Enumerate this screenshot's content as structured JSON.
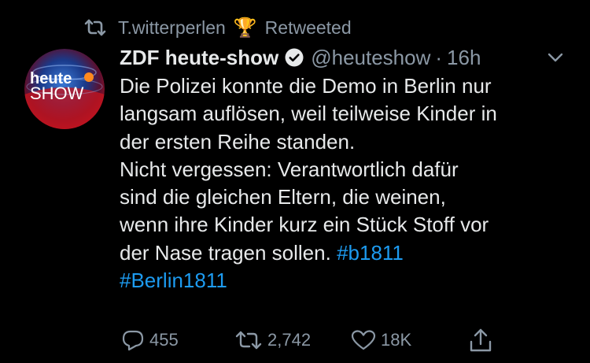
{
  "retweet": {
    "user": "T.witterperlen",
    "trophy_emoji": "🏆",
    "label": "Retweeted",
    "icon": "retweet-icon"
  },
  "author": {
    "display_name": "ZDF heute-show",
    "verified": true,
    "handle": "@heuteshow",
    "separator": "·",
    "time": "16h",
    "avatar_text_top": "heute",
    "avatar_text_bottom": "SHOW",
    "avatar_colors": [
      "#1f3f86",
      "#b3121f"
    ]
  },
  "tweet": {
    "lines": [
      "Die Polizei konnte die Demo in Berlin nur",
      "langsam auflösen, weil teilweise Kinder in",
      "der ersten Reihe standen.",
      "Nicht vergessen: Verantwortlich dafür",
      "sind die gleichen Eltern, die weinen,",
      "wenn ihre Kinder kurz ein Stück Stoff vor",
      "der Nase tragen sollen."
    ],
    "hashtags": [
      "#b1811",
      "#Berlin1811"
    ]
  },
  "actions": {
    "reply": {
      "icon": "reply-icon",
      "count": "455"
    },
    "retweet": {
      "icon": "retweet-icon",
      "count": "2,742"
    },
    "like": {
      "icon": "heart-icon",
      "count": "18K"
    },
    "share": {
      "icon": "share-icon"
    }
  },
  "colors": {
    "background": "#000000",
    "text": "#e7e9ea",
    "secondary": "#8b98a5",
    "link": "#1d9bf0"
  }
}
